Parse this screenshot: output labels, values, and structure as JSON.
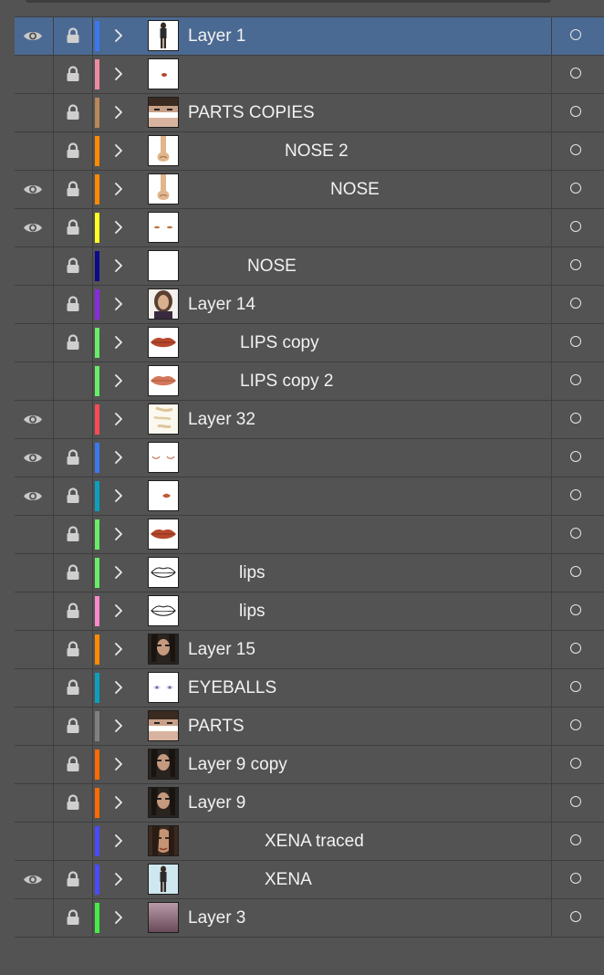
{
  "layers": [
    {
      "name": "Layer 1",
      "visible": true,
      "locked": true,
      "color": "#3b78f0",
      "thumb": "full-figure",
      "selected": true
    },
    {
      "name": "",
      "visible": false,
      "locked": true,
      "color": "#f08aa0",
      "thumb": "small-mark"
    },
    {
      "name": "PARTS COPIES",
      "visible": false,
      "locked": true,
      "color": "#b9875a",
      "thumb": "face-parts"
    },
    {
      "name": "NOSE 2",
      "visible": false,
      "locked": true,
      "color": "#ff8a00",
      "thumb": "nose"
    },
    {
      "name": "NOSE",
      "visible": true,
      "locked": true,
      "color": "#ff8a00",
      "thumb": "nose"
    },
    {
      "name": "",
      "visible": true,
      "locked": true,
      "color": "#ffff22",
      "thumb": "dots"
    },
    {
      "name": "NOSE",
      "visible": false,
      "locked": true,
      "color": "#0a0a8a",
      "thumb": "blank"
    },
    {
      "name": "Layer 14",
      "visible": false,
      "locked": true,
      "color": "#8a2be2",
      "thumb": "portrait"
    },
    {
      "name": "LIPS copy",
      "visible": false,
      "locked": true,
      "color": "#66ee66",
      "thumb": "lips-fill"
    },
    {
      "name": "LIPS copy 2",
      "visible": false,
      "locked": false,
      "color": "#66ee66",
      "thumb": "lips-light"
    },
    {
      "name": "Layer 32",
      "visible": true,
      "locked": false,
      "color": "#ff4a55",
      "thumb": "strokes"
    },
    {
      "name": "",
      "visible": true,
      "locked": true,
      "color": "#3b78f0",
      "thumb": "eyes-closed"
    },
    {
      "name": "",
      "visible": true,
      "locked": true,
      "color": "#0aa0c0",
      "thumb": "small-lips"
    },
    {
      "name": "",
      "visible": false,
      "locked": true,
      "color": "#66ee66",
      "thumb": "lips-fill"
    },
    {
      "name": "lips",
      "visible": false,
      "locked": true,
      "color": "#66ee66",
      "thumb": "lips-outline"
    },
    {
      "name": "lips",
      "visible": false,
      "locked": true,
      "color": "#ff88cc",
      "thumb": "lips-outline"
    },
    {
      "name": "Layer 15",
      "visible": false,
      "locked": true,
      "color": "#ff8a00",
      "thumb": "dark-portrait"
    },
    {
      "name": "EYEBALLS",
      "visible": false,
      "locked": true,
      "color": "#0aa0c0",
      "thumb": "eyeballs"
    },
    {
      "name": "PARTS",
      "visible": false,
      "locked": true,
      "color": "#808080",
      "thumb": "face-parts"
    },
    {
      "name": "Layer 9 copy",
      "visible": false,
      "locked": true,
      "color": "#ff6a00",
      "thumb": "dark-portrait"
    },
    {
      "name": "Layer 9",
      "visible": false,
      "locked": true,
      "color": "#ff6a00",
      "thumb": "dark-portrait"
    },
    {
      "name": "XENA traced",
      "visible": false,
      "locked": false,
      "color": "#4a4aff",
      "thumb": "face-photo"
    },
    {
      "name": "XENA",
      "visible": true,
      "locked": true,
      "color": "#4a4aff",
      "thumb": "full-figure-blue"
    },
    {
      "name": "Layer 3",
      "visible": false,
      "locked": true,
      "color": "#44ee44",
      "thumb": "gradient"
    }
  ]
}
